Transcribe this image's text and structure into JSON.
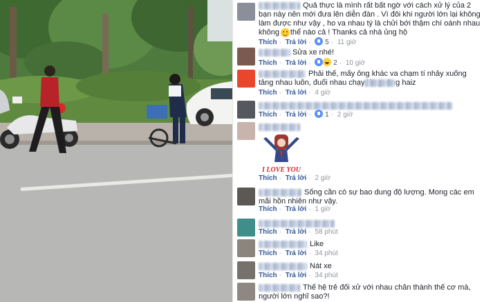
{
  "comments": [
    {
      "text": "Quả thực là mình rất bất ngờ với cách xử lý của 2 bạn này nên mới đưa lên diễn đàn . Vì đôi khi người lớn lại không làm được như vậy , ho va nhau tý là chửi bới thậm chí oánh nhau không ra thể nào cả ! Thanks cả nhà ủng hộ",
      "like": "Thích",
      "reply": "Trả lời",
      "reactions": "5",
      "time": "11 giờ"
    },
    {
      "text": "Sửa xe nhé!",
      "like": "Thích",
      "reply": "Trả lời",
      "reactions": "2",
      "time": "10 giờ"
    },
    {
      "text": "Phải thế, mấy ông khác va chạm tí nhảy xuống tảng nhau luôn, đuổi nhau chạy lòng vòng haiz",
      "like": "Thích",
      "reply": "Trả lời",
      "time": "4 giờ"
    },
    {
      "text": "",
      "like": "Thích",
      "reply": "Trả lời",
      "reactions": "1",
      "time": "2 giờ"
    },
    {
      "sticker_text": "I LOVE YOU",
      "like": "Thích",
      "reply": "Trả lời",
      "time": "2 giờ"
    },
    {
      "text": "Sống cần có sự bao dung độ lượng. Mong các em mãi hồn nhiên như vậy.",
      "like": "Thích",
      "reply": "Trả lời",
      "time": "1 giờ"
    },
    {
      "text": "",
      "like": "Thích",
      "reply": "Trả lời",
      "time": "58 phút"
    },
    {
      "text": "Like",
      "like": "Thích",
      "reply": "Trả lời",
      "time": "34 phút"
    },
    {
      "text": "Nát xe",
      "like": "Thích",
      "reply": "Trả lời",
      "time": "34 phút"
    },
    {
      "text": "Thế hệ trẻ đối xử với nhau chân thành thế cơ mà, người lớn nghĩ sao?!"
    }
  ],
  "colors": {
    "link": "#365899",
    "meta": "#90949c",
    "text": "#1d2129",
    "like_blue": "#5890ff"
  }
}
